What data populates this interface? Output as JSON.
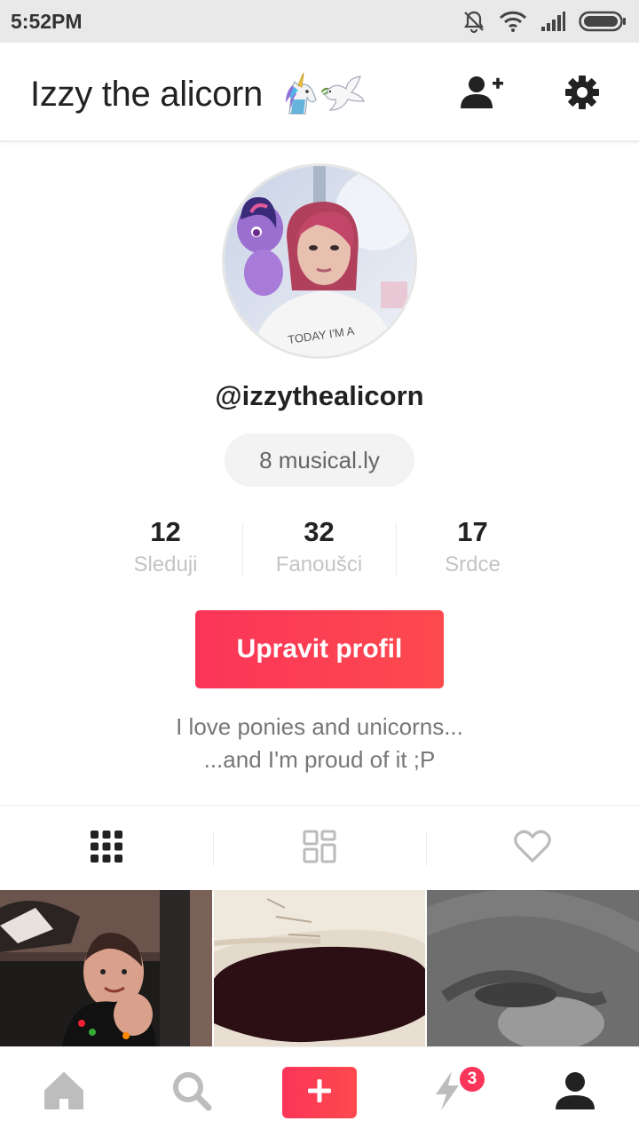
{
  "status_bar": {
    "time": "5:52PM",
    "icons": [
      "bell-muted-icon",
      "wifi-icon",
      "signal-icon",
      "battery-icon"
    ]
  },
  "header": {
    "title": "Izzy the alicorn",
    "title_emoji": [
      "unicorn-emoji",
      "dove-emoji"
    ],
    "actions": [
      "add-friend-icon",
      "settings-icon"
    ]
  },
  "profile": {
    "username": "@izzythealicorn",
    "musical_count": "8 musical.ly",
    "stats": [
      {
        "value": "12",
        "label": "Sleduji"
      },
      {
        "value": "32",
        "label": "Fanoušci"
      },
      {
        "value": "17",
        "label": "Srdce"
      }
    ],
    "edit_button": "Upravit profil",
    "bio_lines": [
      "I love ponies and unicorns...",
      "...and I'm proud of it ;P"
    ]
  },
  "tabs": [
    {
      "icon": "grid-icon",
      "active": true
    },
    {
      "icon": "layout-icon",
      "active": false
    },
    {
      "icon": "heart-icon",
      "active": false
    }
  ],
  "videos": [
    "video-thumbnail-1",
    "video-thumbnail-2",
    "video-thumbnail-3"
  ],
  "bottom_nav": {
    "items": [
      "home-icon",
      "search-icon",
      "create-icon",
      "notifications-icon",
      "profile-icon"
    ],
    "notification_badge": "3"
  },
  "colors": {
    "accent": "#fb3559",
    "status_bar": "#e9e9e9",
    "muted_text": "#c4c4c4"
  }
}
